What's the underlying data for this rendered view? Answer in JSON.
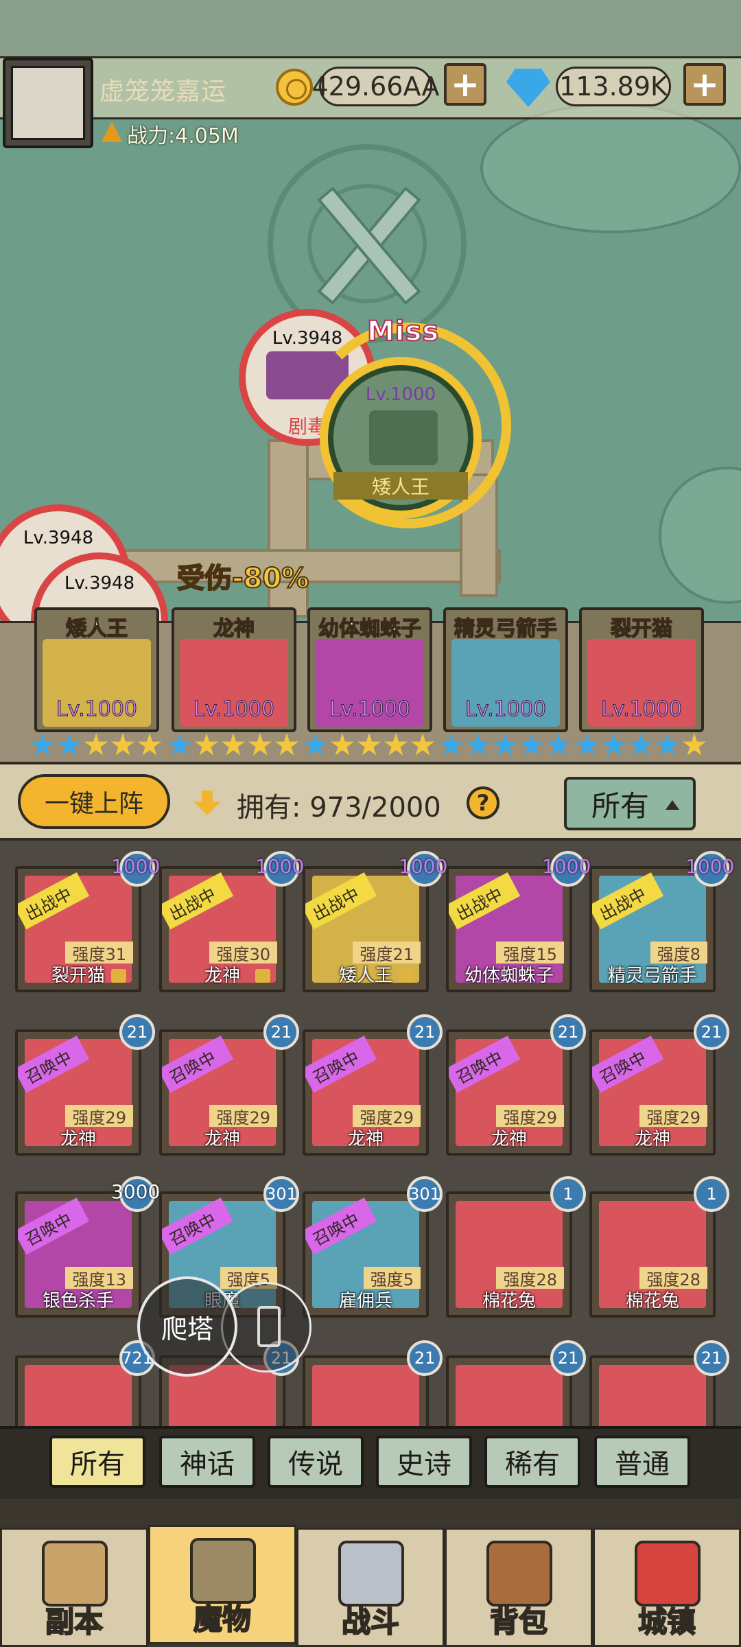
{
  "player": {
    "name": "虚笼笼嘉运",
    "power": "战力:4.05M",
    "gold": "429.66AA",
    "gems": "113.89K"
  },
  "battle": {
    "miss_text": "Miss",
    "damage_text": "受伤-80%",
    "enemies": [
      {
        "level": "Lv.3948",
        "name": "剧毒"
      },
      {
        "level": "Lv.3948"
      },
      {
        "level": "Lv.3948"
      }
    ],
    "hero": {
      "level": "Lv.1000",
      "name": "矮人王"
    }
  },
  "team": [
    {
      "name": "矮人王",
      "level": "Lv.1000",
      "color": "#d4b24a"
    },
    {
      "name": "龙神",
      "level": "Lv.1000",
      "color": "#d9555e"
    },
    {
      "name": "幼体蜘蛛子",
      "level": "Lv.1000",
      "color": "#b347a8"
    },
    {
      "name": "精灵弓箭手",
      "level": "Lv.1000",
      "color": "#5aa2b6"
    },
    {
      "name": "裂开猫",
      "level": "Lv.1000",
      "color": "#d9555e"
    }
  ],
  "collection": {
    "deploy_button": "一键上阵",
    "owned_label": "拥有: 973/2000",
    "help": "?",
    "filter": "所有"
  },
  "tags": {
    "fighting": "出战中",
    "summoning": "召唤中"
  },
  "monsters_row1": [
    {
      "name": "裂开猫",
      "strength": "强度31",
      "count": "1000",
      "color": "#d9555e"
    },
    {
      "name": "龙神",
      "strength": "强度30",
      "count": "1000",
      "color": "#d9555e"
    },
    {
      "name": "矮人王",
      "strength": "强度21",
      "count": "1000",
      "color": "#d4b24a"
    },
    {
      "name": "幼体蜘蛛子",
      "strength": "强度15",
      "count": "1000",
      "color": "#b347a8"
    },
    {
      "name": "精灵弓箭手",
      "strength": "强度8",
      "count": "1000",
      "color": "#5aa2b6"
    }
  ],
  "monsters_row2": [
    {
      "name": "龙神",
      "strength": "强度29",
      "count": "21",
      "color": "#d9555e"
    },
    {
      "name": "龙神",
      "strength": "强度29",
      "count": "21",
      "color": "#d9555e"
    },
    {
      "name": "龙神",
      "strength": "强度29",
      "count": "21",
      "color": "#d9555e"
    },
    {
      "name": "龙神",
      "strength": "强度29",
      "count": "21",
      "color": "#d9555e"
    },
    {
      "name": "龙神",
      "strength": "强度29",
      "count": "21",
      "color": "#d9555e"
    }
  ],
  "monsters_row3": [
    {
      "name": "银色杀手",
      "strength": "强度13",
      "count": "3000",
      "color": "#b347a8"
    },
    {
      "name": "眼魔",
      "strength": "强度5",
      "count": "301",
      "color": "#5aa2b6"
    },
    {
      "name": "雇佣兵",
      "strength": "强度5",
      "count": "301",
      "color": "#5aa2b6"
    },
    {
      "name": "棉花兔",
      "strength": "强度28",
      "count": "1",
      "color": "#d9555e"
    },
    {
      "name": "棉花兔",
      "strength": "强度28",
      "count": "1",
      "color": "#d9555e"
    }
  ],
  "monsters_row4": [
    {
      "count": "721",
      "color": "#d9555e"
    },
    {
      "count": "21",
      "color": "#d9555e"
    },
    {
      "count": "21",
      "color": "#d9555e"
    },
    {
      "count": "21",
      "color": "#d9555e"
    },
    {
      "count": "21",
      "color": "#d9555e"
    }
  ],
  "climb_button": "爬塔",
  "rarity_filters": [
    "所有",
    "神话",
    "传说",
    "史诗",
    "稀有",
    "普通"
  ],
  "nav": [
    "副本",
    "魔物",
    "战斗",
    "背包",
    "城镇"
  ]
}
